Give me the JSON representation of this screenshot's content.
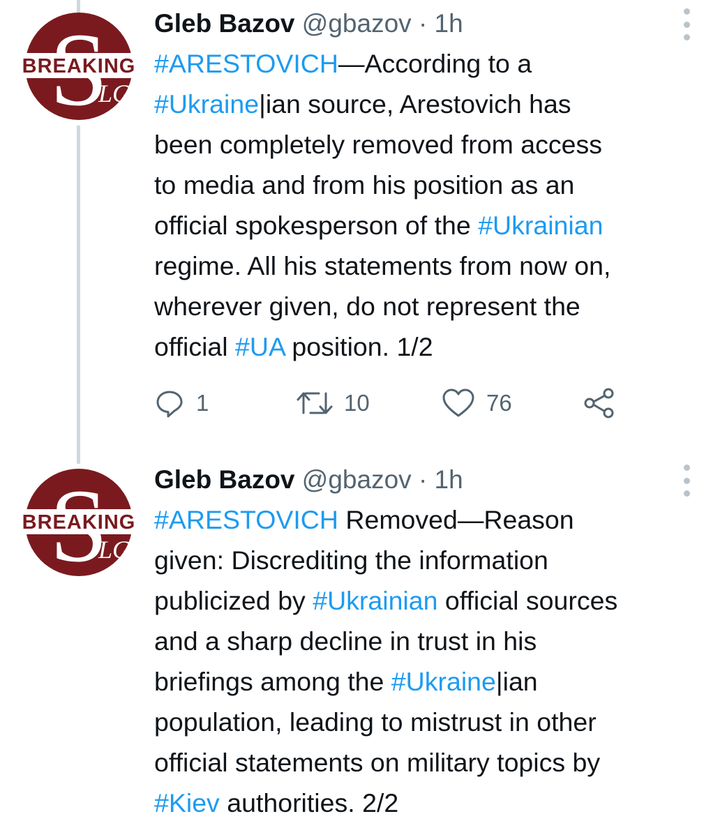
{
  "tweets": [
    {
      "author": {
        "name": "Gleb Bazov",
        "handle": "@gbazov",
        "separator": "·",
        "time": "1h"
      },
      "avatar": {
        "banner_text": "BREAKING",
        "letter": "S",
        "sub_letters": "LG",
        "color": "#7a1a1f"
      },
      "lines": [
        [
          {
            "text": "#ARESTOVICH",
            "tag": true
          },
          {
            "text": "—According to a"
          }
        ],
        [
          {
            "text": "#Ukraine",
            "tag": true
          },
          {
            "text": "|ian source, Arestovich has"
          }
        ],
        [
          {
            "text": "been completely removed from access"
          }
        ],
        [
          {
            "text": "to media and from his position as an"
          }
        ],
        [
          {
            "text": "official spokesperson of the "
          },
          {
            "text": "#Ukrainian",
            "tag": true
          }
        ],
        [
          {
            "text": "regime. All his statements from now on,"
          }
        ],
        [
          {
            "text": "wherever given, do not represent the"
          }
        ],
        [
          {
            "text": "official "
          },
          {
            "text": "#UA",
            "tag": true
          },
          {
            "text": " position. 1/2"
          }
        ]
      ],
      "actions": {
        "replies": "1",
        "retweets": "10",
        "likes": "76"
      }
    },
    {
      "author": {
        "name": "Gleb Bazov",
        "handle": "@gbazov",
        "separator": "·",
        "time": "1h"
      },
      "avatar": {
        "banner_text": "BREAKING",
        "letter": "S",
        "sub_letters": "LG",
        "color": "#7a1a1f"
      },
      "lines": [
        [
          {
            "text": "#ARESTOVICH",
            "tag": true
          },
          {
            "text": " Removed—Reason"
          }
        ],
        [
          {
            "text": "given: Discrediting the information"
          }
        ],
        [
          {
            "text": "publicized by "
          },
          {
            "text": "#Ukrainian",
            "tag": true
          },
          {
            "text": " official sources"
          }
        ],
        [
          {
            "text": "and a sharp decline in trust in his"
          }
        ],
        [
          {
            "text": "briefings among the "
          },
          {
            "text": "#Ukraine",
            "tag": true
          },
          {
            "text": "|ian"
          }
        ],
        [
          {
            "text": "population, leading to mistrust in other"
          }
        ],
        [
          {
            "text": "official statements on military topics by"
          }
        ],
        [
          {
            "text": "#Kiev",
            "tag": true
          },
          {
            "text": " authorities. 2/2"
          }
        ]
      ]
    }
  ],
  "colors": {
    "link": "#1d9bf0",
    "muted": "#536471",
    "thread_line": "#cfd9de"
  }
}
